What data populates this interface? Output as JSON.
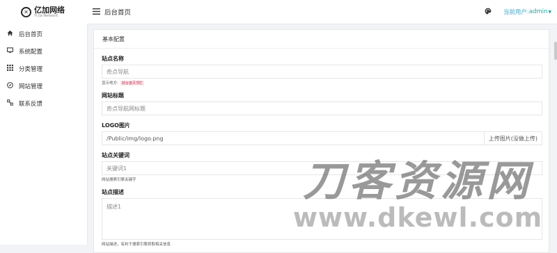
{
  "brand": {
    "name": "亿加网络",
    "sub": "Yi Jia Network"
  },
  "sidebar": {
    "items": [
      {
        "label": "后台首页",
        "icon": "home-icon"
      },
      {
        "label": "系统配置",
        "icon": "monitor-icon"
      },
      {
        "label": "分类管理",
        "icon": "grid-icon"
      },
      {
        "label": "网站管理",
        "icon": "compass-icon"
      },
      {
        "label": "联系反馈",
        "icon": "link-icon"
      }
    ]
  },
  "header": {
    "title": "后台首页",
    "user_label": "当前用户:",
    "user_name": "admin"
  },
  "card": {
    "tab": "基本配置"
  },
  "form": {
    "site_name": {
      "label": "站点名称",
      "placeholder": "奇点导航",
      "hint": "显示地方:",
      "hint_badge": "前台首页顶栏"
    },
    "site_title": {
      "label": "网站标题",
      "placeholder": "奇点导航网标题"
    },
    "logo": {
      "label": "LOGO图片",
      "value": "/Public/img/logo.png",
      "upload": "上传图片(没做上传)"
    },
    "keywords": {
      "label": "站点关键词",
      "placeholder": "关键词1",
      "hint": "网站搜索引擎关键字"
    },
    "description": {
      "label": "站点描述",
      "placeholder": "描述1",
      "hint": "网站描述，有利于搜索引擎抓取相关信息"
    }
  },
  "watermark": {
    "text": "刀客资源网",
    "url": "www.dkewl.com"
  }
}
